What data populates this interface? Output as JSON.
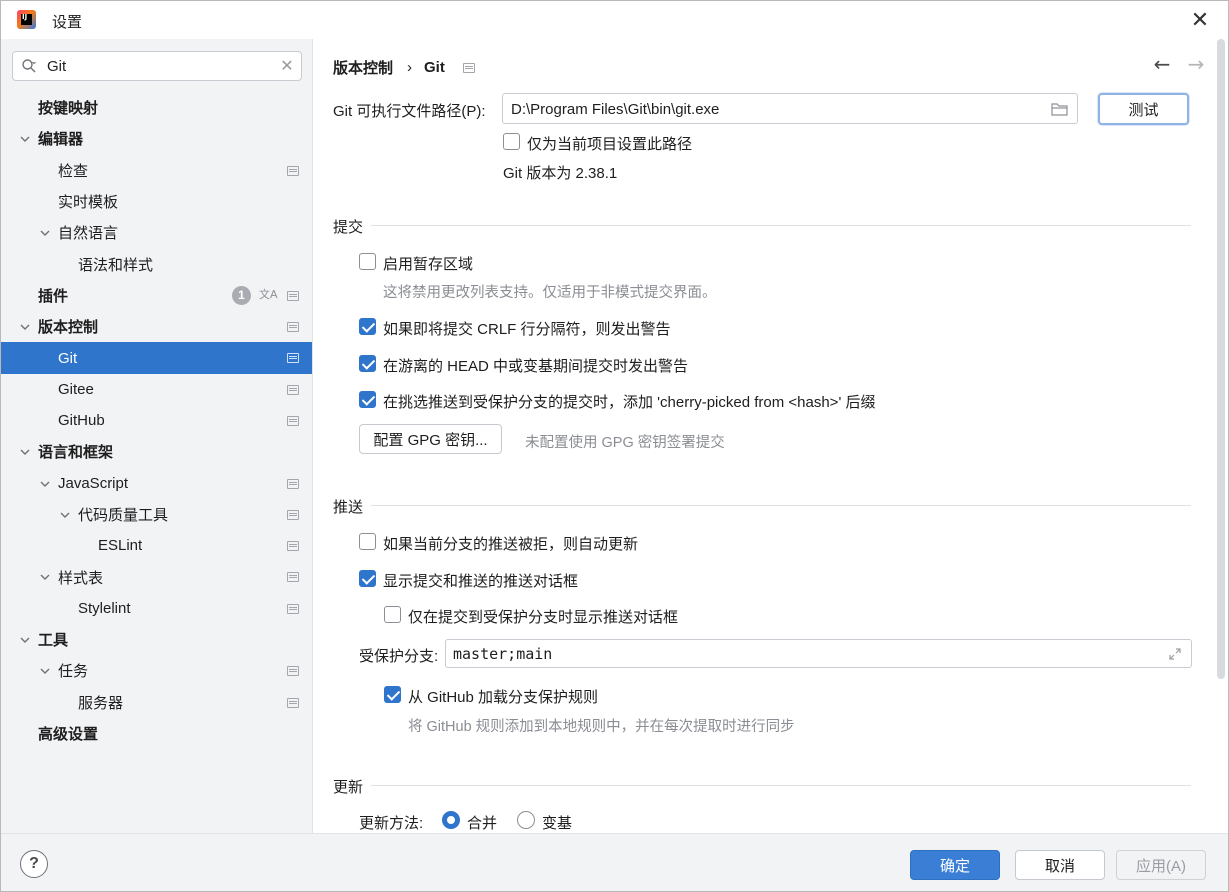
{
  "window": {
    "title": "设置",
    "app_icon_text": "IJ"
  },
  "search": {
    "value": "Git"
  },
  "sidebar": {
    "items": [
      {
        "label": "按键映射",
        "bold": true,
        "level": 0,
        "expanded": null
      },
      {
        "label": "编辑器",
        "bold": true,
        "level": 0,
        "expanded": true
      },
      {
        "label": "检查",
        "level": 1,
        "proj": true
      },
      {
        "label": "实时模板",
        "level": 1
      },
      {
        "label": "自然语言",
        "level": 1,
        "expanded": true
      },
      {
        "label": "语法和样式",
        "level": 2
      },
      {
        "label": "插件",
        "bold": true,
        "level": 0,
        "badge": "1",
        "translate": true,
        "proj": true
      },
      {
        "label": "版本控制",
        "bold": true,
        "level": 0,
        "expanded": true,
        "proj": true
      },
      {
        "label": "Git",
        "level": 1,
        "selected": true,
        "proj": true
      },
      {
        "label": "Gitee",
        "level": 1,
        "proj": true
      },
      {
        "label": "GitHub",
        "level": 1,
        "proj": true
      },
      {
        "label": "语言和框架",
        "bold": true,
        "level": 0,
        "expanded": true
      },
      {
        "label": "JavaScript",
        "level": 1,
        "expanded": true,
        "proj": true
      },
      {
        "label": "代码质量工具",
        "level": 2,
        "expanded": true,
        "proj": true
      },
      {
        "label": "ESLint",
        "level": 3,
        "proj": true
      },
      {
        "label": "样式表",
        "level": 1,
        "expanded": true,
        "proj": true
      },
      {
        "label": "Stylelint",
        "level": 2,
        "proj": true
      },
      {
        "label": "工具",
        "bold": true,
        "level": 0,
        "expanded": true
      },
      {
        "label": "任务",
        "level": 1,
        "expanded": true,
        "proj": true
      },
      {
        "label": "服务器",
        "level": 2,
        "proj": true
      },
      {
        "label": "高级设置",
        "bold": true,
        "level": 0
      }
    ]
  },
  "breadcrumb": {
    "parent": "版本控制",
    "sep": "›",
    "current": "Git"
  },
  "git": {
    "path_label": "Git 可执行文件路径(P):",
    "path_value": "D:\\Program Files\\Git\\bin\\git.exe",
    "test_button": "测试",
    "project_only_label": "仅为当前项目设置此路径",
    "version_text": "Git 版本为 2.38.1"
  },
  "commit": {
    "title": "提交",
    "staging_label": "启用暂存区域",
    "staging_hint": "这将禁用更改列表支持。仅适用于非模式提交界面。",
    "crlf_label": "如果即将提交 CRLF 行分隔符，则发出警告",
    "detached_label": "在游离的 HEAD 中或变基期间提交时发出警告",
    "cherry_label": "在挑选推送到受保护分支的提交时，添加 'cherry-picked from <hash>' 后缀",
    "gpg_button": "配置 GPG 密钥...",
    "gpg_hint": "未配置使用 GPG 密钥签署提交"
  },
  "push": {
    "title": "推送",
    "auto_update_label": "如果当前分支的推送被拒，则自动更新",
    "show_dialog_label": "显示提交和推送的推送对话框",
    "protected_only_label": "仅在提交到受保护分支时显示推送对话框",
    "protected_branches_label": "受保护分支:",
    "protected_branches_value": "master;main",
    "github_rules_label": "从 GitHub 加载分支保护规则",
    "github_rules_hint": "将 GitHub 规则添加到本地规则中，并在每次提取时进行同步"
  },
  "update": {
    "title": "更新",
    "method_label": "更新方法:",
    "merge_label": "合并",
    "rebase_label": "变基"
  },
  "footer": {
    "help": "?",
    "ok": "确定",
    "cancel": "取消",
    "apply": "应用(A)"
  },
  "colors": {
    "accent": "#2f75cc",
    "sidebar_bg": "#f2f3f5"
  }
}
